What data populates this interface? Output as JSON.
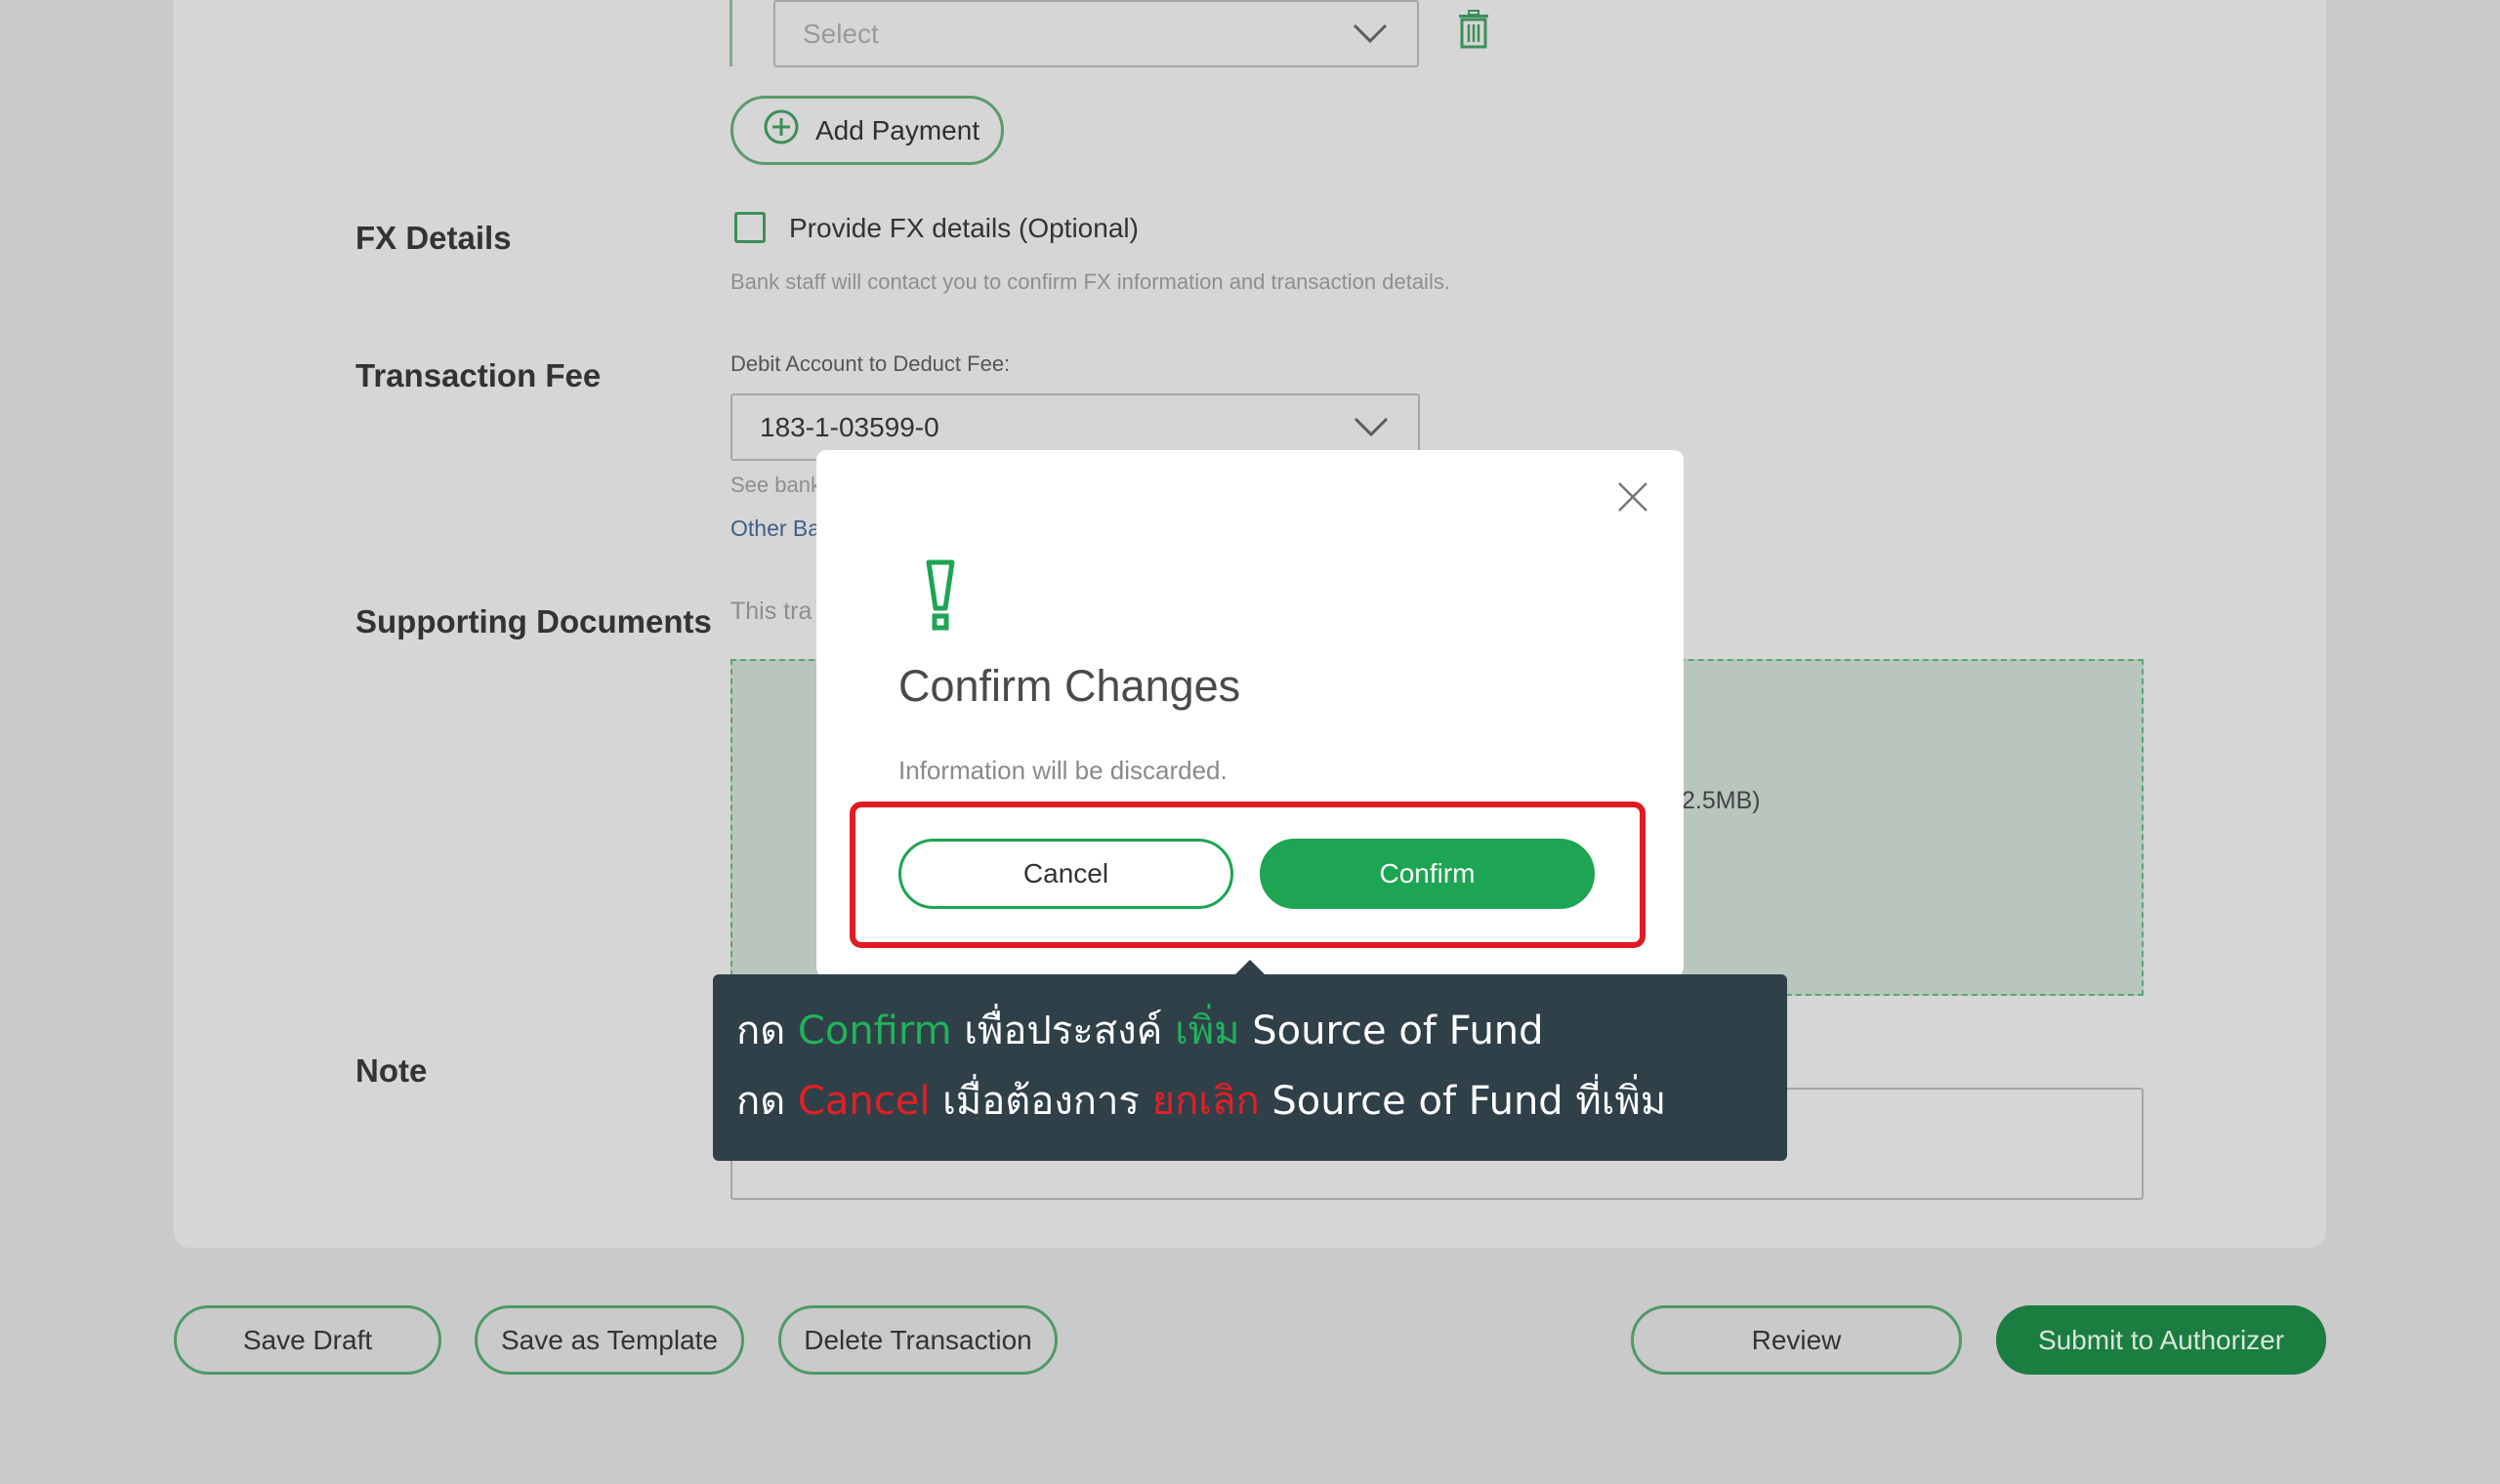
{
  "form": {
    "payment_select_placeholder": "Select",
    "add_payment_label": "Add Payment",
    "fx": {
      "label": "FX Details",
      "checkbox_label": "Provide FX details (Optional)",
      "hint": "Bank staff will contact you to confirm FX information and transaction details."
    },
    "fee": {
      "label": "Transaction Fee",
      "debit_label": "Debit Account to Deduct Fee:",
      "debit_value": "183-1-03599-0",
      "hint_partial": "See bank",
      "link_partial": "Other Ba"
    },
    "docs": {
      "label": "Supporting Documents",
      "hint_partial": "This tra",
      "size_partial": "2.5MB)"
    },
    "note": {
      "label": "Note"
    }
  },
  "footer": {
    "save_draft": "Save Draft",
    "save_template": "Save as Template",
    "delete_transaction": "Delete Transaction",
    "review": "Review",
    "submit": "Submit to Authorizer"
  },
  "modal": {
    "title": "Confirm Changes",
    "message": "Information will be discarded.",
    "cancel_label": "Cancel",
    "confirm_label": "Confirm"
  },
  "tooltip": {
    "line1": {
      "p1": "กด ",
      "p2": "Confirm",
      "p3": " เพื่อประสงค์ ",
      "p4": "เพิ่ม",
      "p5": " Source of Fund"
    },
    "line2": {
      "p1": "กด ",
      "p2": "Cancel",
      "p3": " เมื่อต้องการ ",
      "p4": "ยกเลิก",
      "p5": " Source of Fund ที่เพิ่ม"
    }
  },
  "colors": {
    "brand_green": "#1da553",
    "alert_red": "#e01b22",
    "tooltip_bg": "#2f4049",
    "overlay_gray": "#cacaca"
  }
}
